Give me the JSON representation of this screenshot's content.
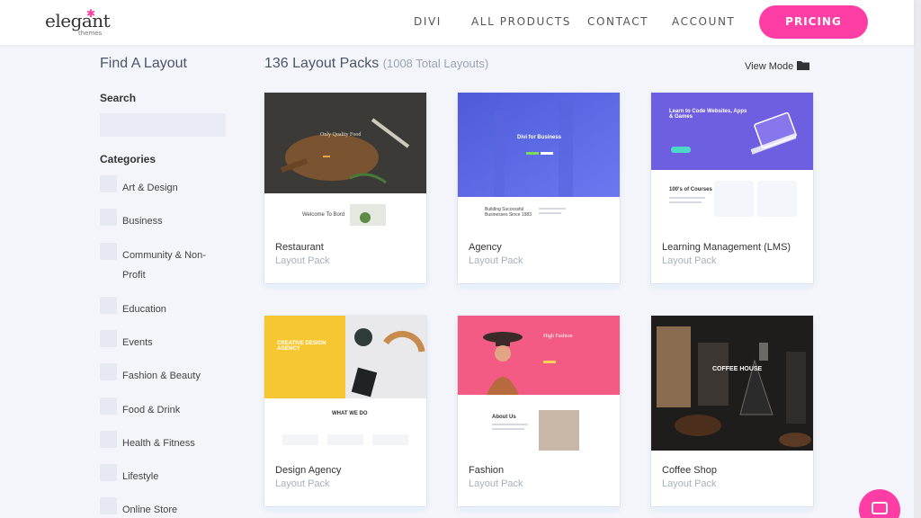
{
  "nav": {
    "logo_word": "elegant",
    "logo_sub": "themes",
    "links": [
      "DIVI",
      "ALL PRODUCTS",
      "CONTACT",
      "ACCOUNT"
    ],
    "cta": "PRICING",
    "accent_color": "#ff3ea5"
  },
  "sidebar": {
    "title": "Find A Layout",
    "search_label": "Search",
    "search_value": "",
    "categories_label": "Categories",
    "categories": [
      "Art & Design",
      "Business",
      "Community & Non-Profit",
      "Education",
      "Events",
      "Fashion & Beauty",
      "Food & Drink",
      "Health & Fitness",
      "Lifestyle",
      "Online Store"
    ]
  },
  "main": {
    "title": "136 Layout Packs",
    "subtitle": "(1008 Total Layouts)",
    "view_mode_label": "View Mode",
    "view_mode_icon": "folder-icon",
    "cards": [
      {
        "name": "Restaurant",
        "type": "Layout Pack",
        "thumb_headline": "Only Quality Food",
        "thumb_sub": "Welcome To Bord"
      },
      {
        "name": "Agency",
        "type": "Layout Pack",
        "thumb_headline": "Divi for Business",
        "thumb_sub": "Building Successful Businesses Since 1983"
      },
      {
        "name": "Learning Management (LMS)",
        "type": "Layout Pack",
        "thumb_headline": "Learn to Code Websites, Apps & Games",
        "thumb_sub": "100's of Courses"
      },
      {
        "name": "Design Agency",
        "type": "Layout Pack",
        "thumb_headline": "CREATIVE DESIGN AGENCY",
        "thumb_sub": "WHAT WE DO"
      },
      {
        "name": "Fashion",
        "type": "Layout Pack",
        "thumb_headline": "High Fashion",
        "thumb_sub": "About Us"
      },
      {
        "name": "Coffee Shop",
        "type": "Layout Pack",
        "thumb_headline": "COFFEE HOUSE",
        "thumb_sub": ""
      }
    ]
  }
}
